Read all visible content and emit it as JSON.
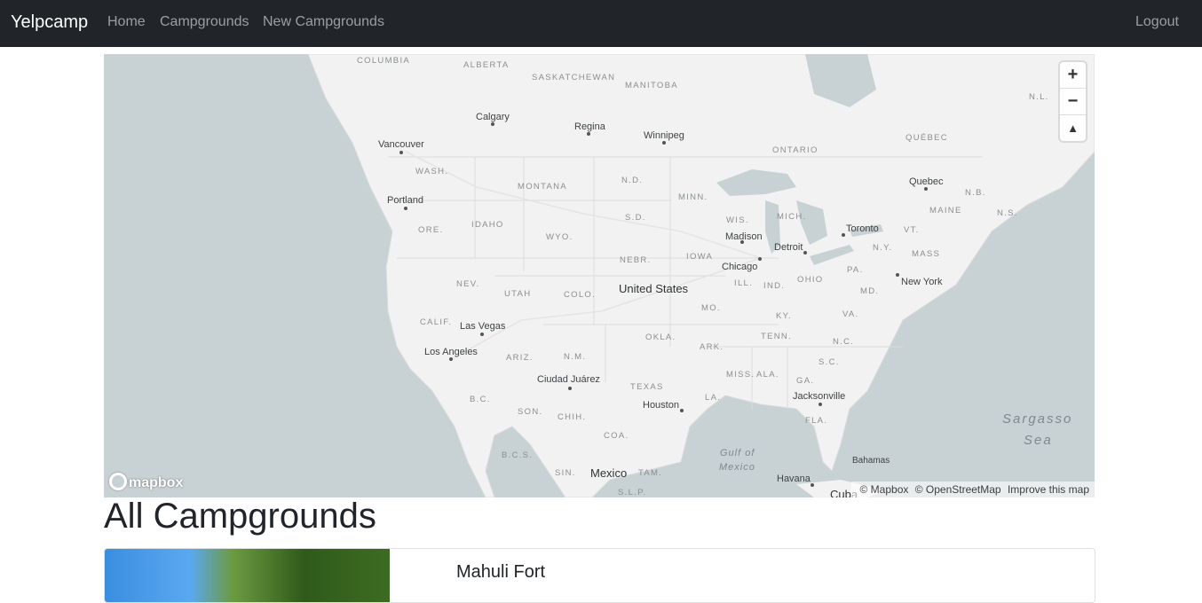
{
  "navbar": {
    "brand": "Yelpcamp",
    "links": [
      "Home",
      "Campgrounds",
      "New Campgrounds"
    ],
    "logout": "Logout"
  },
  "map": {
    "controls": {
      "zoom_in": "+",
      "zoom_out": "−",
      "compass": "▲"
    },
    "logo": "mapbox",
    "attribution": [
      "© Mapbox",
      "© OpenStreetMap",
      "Improve this map"
    ],
    "labels": {
      "regions": [
        "COLUMBIA",
        "ALBERTA",
        "SASKATCHEWAN",
        "MANITOBA",
        "ONTARIO",
        "QUÉBEC",
        "N.L.",
        "N.B.",
        "N.S.",
        "MAINE",
        "VT.",
        "N.Y.",
        "MASS",
        "PA.",
        "MD.",
        "WASH.",
        "MONTANA",
        "N.D.",
        "MINN.",
        "WIS.",
        "MICH.",
        "S.D.",
        "ORE.",
        "IDAHO",
        "WYO.",
        "NEBR.",
        "IOWA",
        "ILL.",
        "IND.",
        "OHIO",
        "NEV.",
        "UTAH",
        "COLO.",
        "MO.",
        "KY.",
        "VA.",
        "CALIF.",
        "ARIZ.",
        "N.M.",
        "OKLA.",
        "ARK.",
        "TENN.",
        "N.C.",
        "S.C.",
        "TEXAS",
        "MISS.",
        "ALA.",
        "GA.",
        "LA.",
        "FLA.",
        "B.C.",
        "SON.",
        "CHIH.",
        "COA.",
        "B.C.S.",
        "SIN.",
        "TAM.",
        "S.L.P."
      ],
      "cities": [
        "Calgary",
        "Regina",
        "Winnipeg",
        "Vancouver",
        "Portland",
        "Quebec",
        "Toronto",
        "Madison",
        "Detroit",
        "Chicago",
        "New York",
        "Las Vegas",
        "Los Angeles",
        "Ciudad Juárez",
        "Houston",
        "Jacksonville",
        "Havana",
        "Bahamas"
      ],
      "countries": [
        "United States",
        "Mexico",
        "Cuba"
      ],
      "water": [
        "Sargasso",
        "Sea",
        "Gulf of",
        "Mexico"
      ]
    }
  },
  "page": {
    "heading": "All Campgrounds",
    "campgrounds": [
      {
        "title": "Mahuli Fort"
      }
    ]
  }
}
